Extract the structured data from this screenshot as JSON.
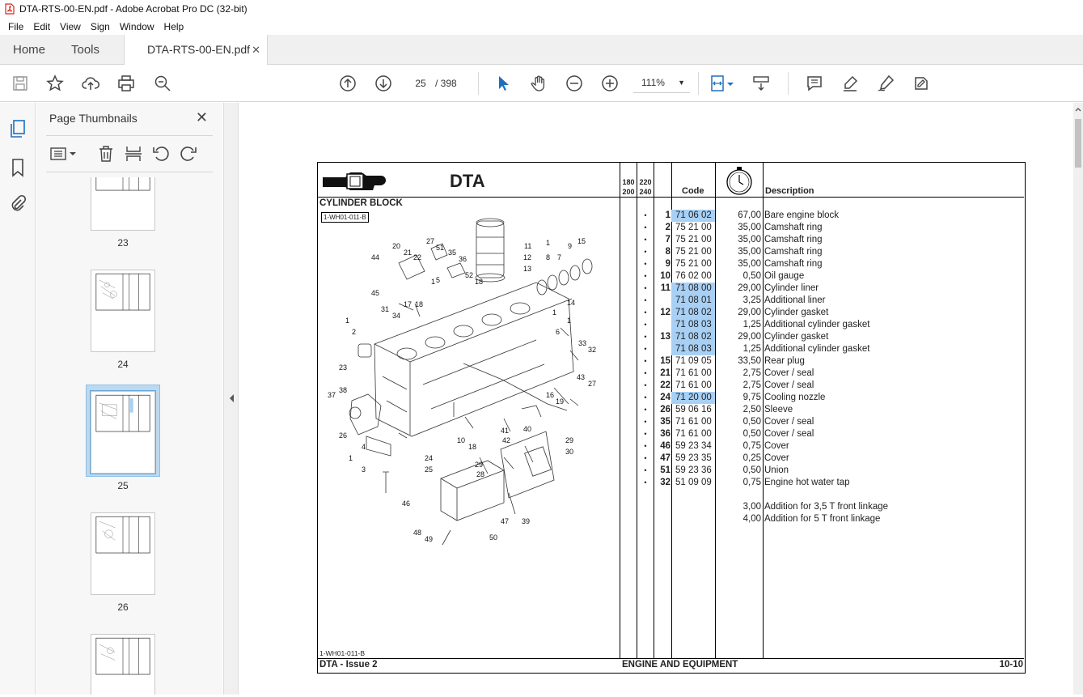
{
  "window": {
    "title": "DTA-RTS-00-EN.pdf - Adobe Acrobat Pro DC (32-bit)"
  },
  "menu": [
    "File",
    "Edit",
    "View",
    "Sign",
    "Window",
    "Help"
  ],
  "tabs": {
    "home": "Home",
    "tools": "Tools",
    "document": "DTA-RTS-00-EN.pdf"
  },
  "toolbar": {
    "page_current": "25",
    "page_total": "/ 398",
    "zoom": "111%"
  },
  "thumbnails": {
    "title": "Page Thumbnails",
    "pages": [
      "23",
      "24",
      "25",
      "26"
    ],
    "selected": "25"
  },
  "doc": {
    "brand": "DTA",
    "block_title": "CYLINDER BLOCK",
    "figure_ref": "1-WH01-011-B",
    "col_model_a": "180\n200",
    "col_model_b": "220\n240",
    "col_code": "Code",
    "col_desc": "Description",
    "footer_left": "DTA - Issue 2",
    "footer_center": "ENGINE AND EQUIPMENT",
    "footer_right": "10-10",
    "rows": [
      {
        "dot": "•",
        "num": "1",
        "code": "71 06 02",
        "hl": true,
        "time": "67,00",
        "desc": "Bare engine block"
      },
      {
        "dot": "•",
        "num": "2",
        "code": "75 21 00",
        "hl": false,
        "time": "35,00",
        "desc": "Camshaft ring"
      },
      {
        "dot": "•",
        "num": "7",
        "code": "75 21 00",
        "hl": false,
        "time": "35,00",
        "desc": "Camshaft ring"
      },
      {
        "dot": "•",
        "num": "8",
        "code": "75 21 00",
        "hl": false,
        "time": "35,00",
        "desc": "Camshaft ring"
      },
      {
        "dot": "•",
        "num": "9",
        "code": "75 21 00",
        "hl": false,
        "time": "35,00",
        "desc": "Camshaft ring"
      },
      {
        "dot": "•",
        "num": "10",
        "code": "76 02 00",
        "hl": false,
        "time": "0,50",
        "desc": "Oil gauge"
      },
      {
        "dot": "•",
        "num": "11",
        "code": "71 08 00",
        "hl": true,
        "time": "29,00",
        "desc": "Cylinder liner"
      },
      {
        "dot": "•",
        "num": "",
        "code": "71 08 01",
        "hl": true,
        "time": "3,25",
        "desc": "Additional liner"
      },
      {
        "dot": "•",
        "num": "12",
        "code": "71 08 02",
        "hl": true,
        "time": "29,00",
        "desc": "Cylinder gasket"
      },
      {
        "dot": "•",
        "num": "",
        "code": "71 08 03",
        "hl": true,
        "time": "1,25",
        "desc": "Additional cylinder gasket"
      },
      {
        "dot": "•",
        "num": "13",
        "code": "71 08 02",
        "hl": true,
        "time": "29,00",
        "desc": "Cylinder gasket"
      },
      {
        "dot": "•",
        "num": "",
        "code": "71 08 03",
        "hl": true,
        "time": "1,25",
        "desc": "Additional cylinder gasket"
      },
      {
        "dot": "•",
        "num": "15",
        "code": "71 09 05",
        "hl": false,
        "time": "33,50",
        "desc": "Rear plug"
      },
      {
        "dot": "•",
        "num": "21",
        "code": "71 61 00",
        "hl": false,
        "time": "2,75",
        "desc": "Cover / seal"
      },
      {
        "dot": "•",
        "num": "22",
        "code": "71 61 00",
        "hl": false,
        "time": "2,75",
        "desc": "Cover / seal"
      },
      {
        "dot": "•",
        "num": "24",
        "code": "71 20 00",
        "hl": true,
        "time": "9,75",
        "desc": "Cooling nozzle"
      },
      {
        "dot": "•",
        "num": "26",
        "code": "59 06 16",
        "hl": false,
        "time": "2,50",
        "desc": "Sleeve"
      },
      {
        "dot": "•",
        "num": "35",
        "code": "71 61 00",
        "hl": false,
        "time": "0,50",
        "desc": "Cover / seal"
      },
      {
        "dot": "•",
        "num": "36",
        "code": "71 61 00",
        "hl": false,
        "time": "0,50",
        "desc": "Cover / seal"
      },
      {
        "dot": "•",
        "num": "46",
        "code": "59 23 34",
        "hl": false,
        "time": "0,75",
        "desc": "Cover"
      },
      {
        "dot": "•",
        "num": "47",
        "code": "59 23 35",
        "hl": false,
        "time": "0,25",
        "desc": "Cover"
      },
      {
        "dot": "•",
        "num": "51",
        "code": "59 23 36",
        "hl": false,
        "time": "0,50",
        "desc": "Union"
      },
      {
        "dot": "•",
        "num": "32",
        "code": "51 09 09",
        "hl": false,
        "time": "0,75",
        "desc": "Engine hot water tap"
      },
      {
        "dot": "",
        "num": "",
        "code": "",
        "hl": false,
        "time": "",
        "desc": ""
      },
      {
        "dot": "",
        "num": "",
        "code": "",
        "hl": true,
        "time": "3,00",
        "desc": "Addition for 3,5 T front linkage"
      },
      {
        "dot": "",
        "num": "",
        "code": "",
        "hl": true,
        "time": "4,00",
        "desc": "Addition for 5 T front linkage"
      }
    ],
    "callouts": [
      "1",
      "2",
      "3",
      "4",
      "5",
      "6",
      "7",
      "8",
      "9",
      "10",
      "11",
      "12",
      "13",
      "14",
      "15",
      "16",
      "17",
      "18",
      "19",
      "20",
      "21",
      "22",
      "23",
      "24",
      "25",
      "26",
      "27",
      "28",
      "29",
      "30",
      "31",
      "32",
      "33",
      "34",
      "35",
      "36",
      "37",
      "38",
      "39",
      "40",
      "41",
      "42",
      "43",
      "44",
      "45",
      "46",
      "47",
      "48",
      "49",
      "50",
      "51",
      "52"
    ]
  },
  "colors": {
    "highlight": "#a8d0f5",
    "selected_thumb": "#bcd9f0",
    "acrobat_red": "#d7261e"
  }
}
